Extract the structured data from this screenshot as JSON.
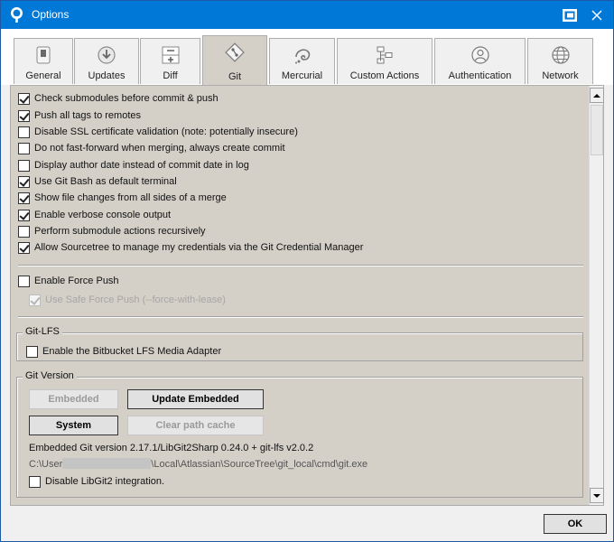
{
  "window": {
    "title": "Options"
  },
  "tabs": [
    {
      "label": "General",
      "icon": "switch-icon"
    },
    {
      "label": "Updates",
      "icon": "download-circle-icon"
    },
    {
      "label": "Diff",
      "icon": "diff-icon"
    },
    {
      "label": "Git",
      "icon": "git-diamond-icon",
      "active": true
    },
    {
      "label": "Mercurial",
      "icon": "mercurial-icon"
    },
    {
      "label": "Custom Actions",
      "icon": "custom-actions-icon"
    },
    {
      "label": "Authentication",
      "icon": "user-circle-icon"
    },
    {
      "label": "Network",
      "icon": "globe-icon"
    }
  ],
  "git": {
    "options": [
      {
        "label": "Check submodules before commit & push",
        "checked": true
      },
      {
        "label": "Push all tags to remotes",
        "checked": true
      },
      {
        "label": "Disable SSL certificate validation (note: potentially insecure)",
        "checked": false
      },
      {
        "label": "Do not fast-forward when merging, always create commit",
        "checked": false
      },
      {
        "label": "Display author date instead of commit date in log",
        "checked": false
      },
      {
        "label": "Use Git Bash as default terminal",
        "checked": true
      },
      {
        "label": "Show file changes from all sides of a merge",
        "checked": true
      },
      {
        "label": "Enable verbose console output",
        "checked": true
      },
      {
        "label": "Perform submodule actions recursively",
        "checked": false
      },
      {
        "label": "Allow Sourcetree to manage my credentials via the Git Credential Manager",
        "checked": true
      }
    ],
    "force_push": {
      "label": "Enable Force Push",
      "checked": false
    },
    "safe_force_push": {
      "label": "Use Safe Force Push (--force-with-lease)",
      "checked": true,
      "disabled": true
    },
    "git_lfs": {
      "group_title": "Git-LFS",
      "media_adapter": {
        "label": "Enable the Bitbucket LFS Media Adapter",
        "checked": false
      }
    },
    "git_version": {
      "group_title": "Git Version",
      "buttons": {
        "embedded": "Embedded",
        "update_embedded": "Update Embedded",
        "system": "System",
        "clear_path_cache": "Clear path cache"
      },
      "version_text": "Embedded Git version 2.17.1/LibGit2Sharp 0.24.0 + git-lfs v2.0.2",
      "path_prefix": "C:\\User",
      "path_suffix": "\\Local\\Atlassian\\SourceTree\\git_local\\cmd\\git.exe",
      "disable_libgit2": {
        "label": "Disable LibGit2 integration.",
        "checked": false
      }
    }
  },
  "footer": {
    "ok_label": "OK"
  }
}
